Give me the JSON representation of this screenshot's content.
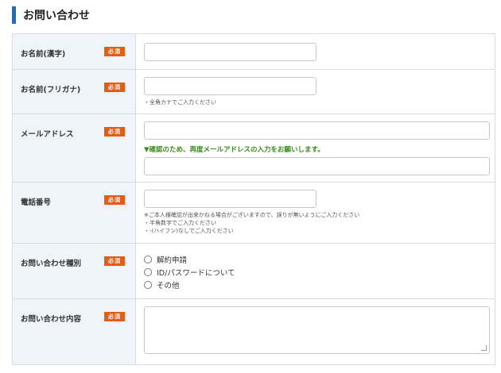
{
  "heading": "お問い合わせ",
  "required_label": "必須",
  "rows": {
    "name_kanji": {
      "label": "お名前(漢字)",
      "value": ""
    },
    "name_kana": {
      "label": "お名前(フリガナ)",
      "value": "",
      "note": "・全角カナでご入力ください"
    },
    "email": {
      "label": "メールアドレス",
      "value": "",
      "confirm_note": "▼確認のため、再度メールアドレスの入力をお願いします。",
      "confirm_value": ""
    },
    "phone": {
      "label": "電話番号",
      "value": "",
      "notes": [
        "※ご本人様確認が出来かねる場合がございますので、誤りが無いようにご入力ください",
        "・半角数字でご入力ください",
        "・-(ハイフン)なしでご入力ください"
      ]
    },
    "inquiry_type": {
      "label": "お問い合わせ種別",
      "options": [
        "解約申請",
        "ID/パスワードについて",
        "その他"
      ]
    },
    "inquiry_content": {
      "label": "お問い合わせ内容",
      "value": ""
    }
  }
}
